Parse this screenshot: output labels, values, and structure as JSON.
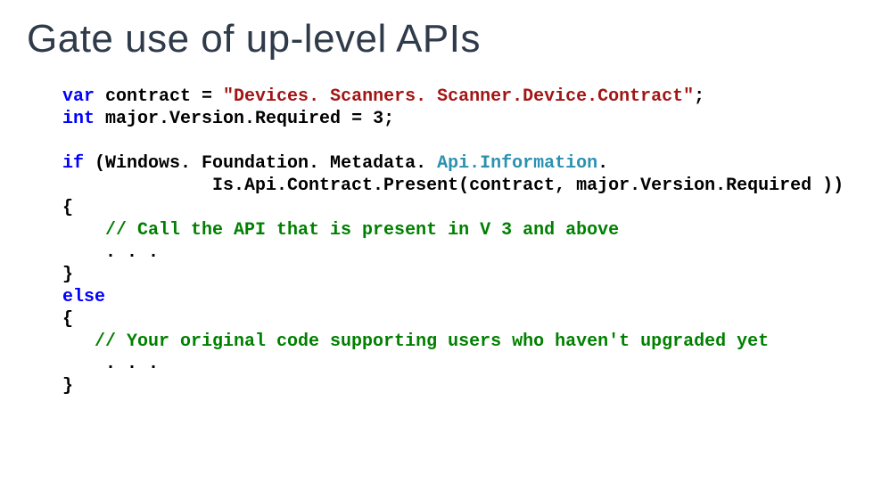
{
  "title": "Gate use of up-level APIs",
  "code": {
    "l01_var": "var",
    "l01_contract": " contract = ",
    "l01_str": "\"Devices. Scanners. Scanner.Device.Contract\"",
    "l01_end": ";",
    "l02_int": "int",
    "l02_rest": " major.Version.Required = 3;",
    "l03_blank": " ",
    "l04_if": "if",
    "l04_p1": " (Windows. Foundation. Metadata. ",
    "l04_api": "Api.Information",
    "l04_p2": ".",
    "l05_indent": "              Is.Api.Contract.Present(contract, major.Version.Required ))",
    "l06_brace": "{",
    "l07_comment": "    // Call the API that is present in V 3 and above",
    "l08_dots": "    . . .",
    "l09_brace": "}",
    "l10_else": "else",
    "l11_brace": "{",
    "l12_comment": "   // Your original code supporting users who haven't upgraded yet",
    "l13_dots": "    . . .",
    "l14_brace": "}"
  }
}
